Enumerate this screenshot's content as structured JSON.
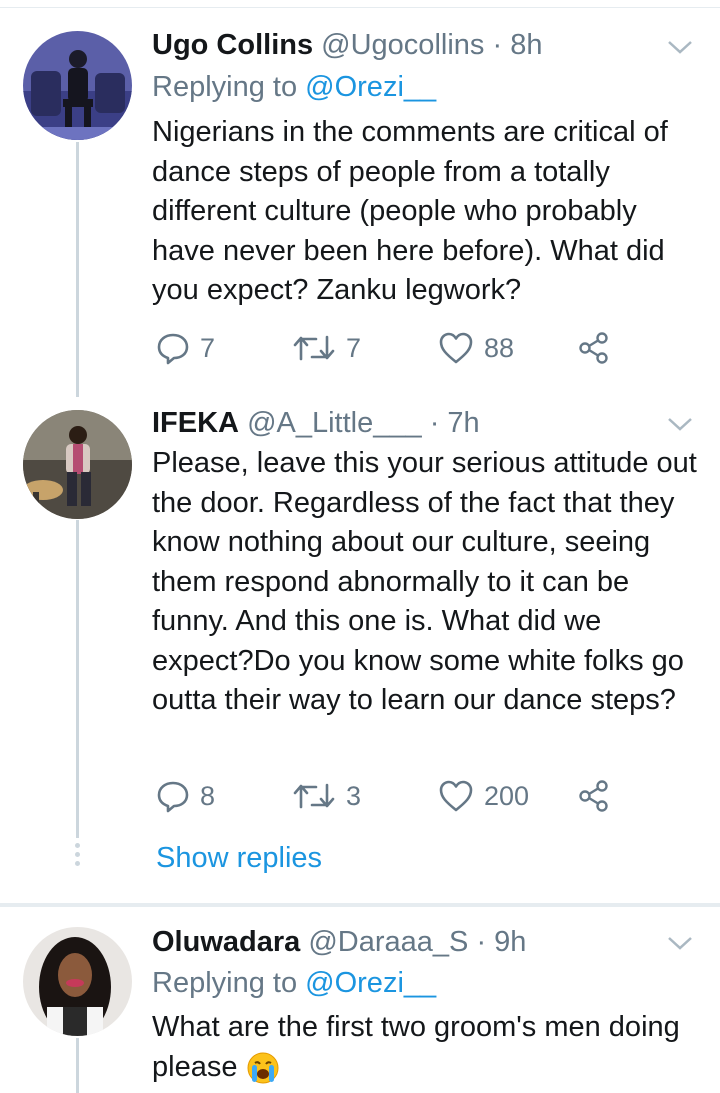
{
  "tweets": [
    {
      "name": "Ugo Collins",
      "handle": "@Ugocollins",
      "separator": "·",
      "time": "8h",
      "replying_prefix": "Replying to",
      "replying_to": "@Orezi__",
      "text": "Nigerians in the comments are critical of dance steps of people from a totally different culture (people who probably have never been here before). What did you expect? Zanku legwork?",
      "replies": "7",
      "retweets": "7",
      "likes": "88"
    },
    {
      "name": "IFEKA",
      "handle": "@A_Little___",
      "separator": "·",
      "time": "7h",
      "text": "Please, leave this your serious attitude out the door. Regardless of the fact that they know nothing about our culture, seeing them respond abnormally to it can be funny. And this one is. What did we expect?Do you know some white folks go outta their way to learn our dance steps?",
      "replies": "8",
      "retweets": "3",
      "likes": "200"
    },
    {
      "name": "Oluwadara",
      "handle": "@Daraaa_S",
      "separator": "·",
      "time": "9h",
      "replying_prefix": "Replying to",
      "replying_to": "@Orezi__",
      "text": "What are the first two groom's men doing please"
    }
  ],
  "show_replies_label": "Show replies",
  "icons": {
    "reply": "reply-icon",
    "retweet": "retweet-icon",
    "like": "heart-icon",
    "share": "share-icon",
    "caret": "chevron-down-icon",
    "emoji": "loudly-crying-face-emoji"
  },
  "colors": {
    "link": "#1b95e0",
    "secondary": "#657786",
    "text": "#14171a",
    "divider": "#e6ecf0"
  }
}
